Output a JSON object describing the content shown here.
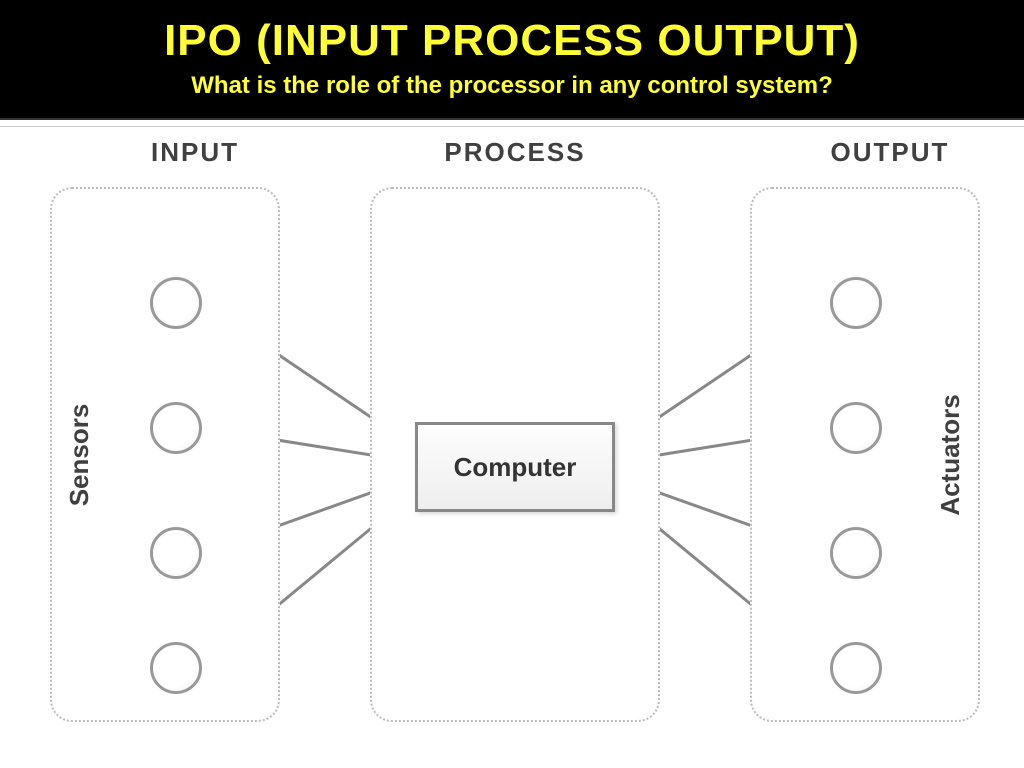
{
  "header": {
    "title": "IPO (INPUT PROCESS OUTPUT)",
    "subtitle": "What is the role of the processor in any control system?"
  },
  "diagram": {
    "columns": {
      "input": "INPUT",
      "process": "PROCESS",
      "output": "OUTPUT"
    },
    "input_group_label": "Sensors",
    "output_group_label": "Actuators",
    "process_node": "Computer",
    "input_node_count": 4,
    "output_node_count": 4,
    "flow": "Sensors → Computer → Actuators"
  },
  "colors": {
    "title_text": "#ffff33",
    "header_bg": "#000000",
    "node_stroke": "#999999",
    "arrow_stroke": "#888888"
  }
}
